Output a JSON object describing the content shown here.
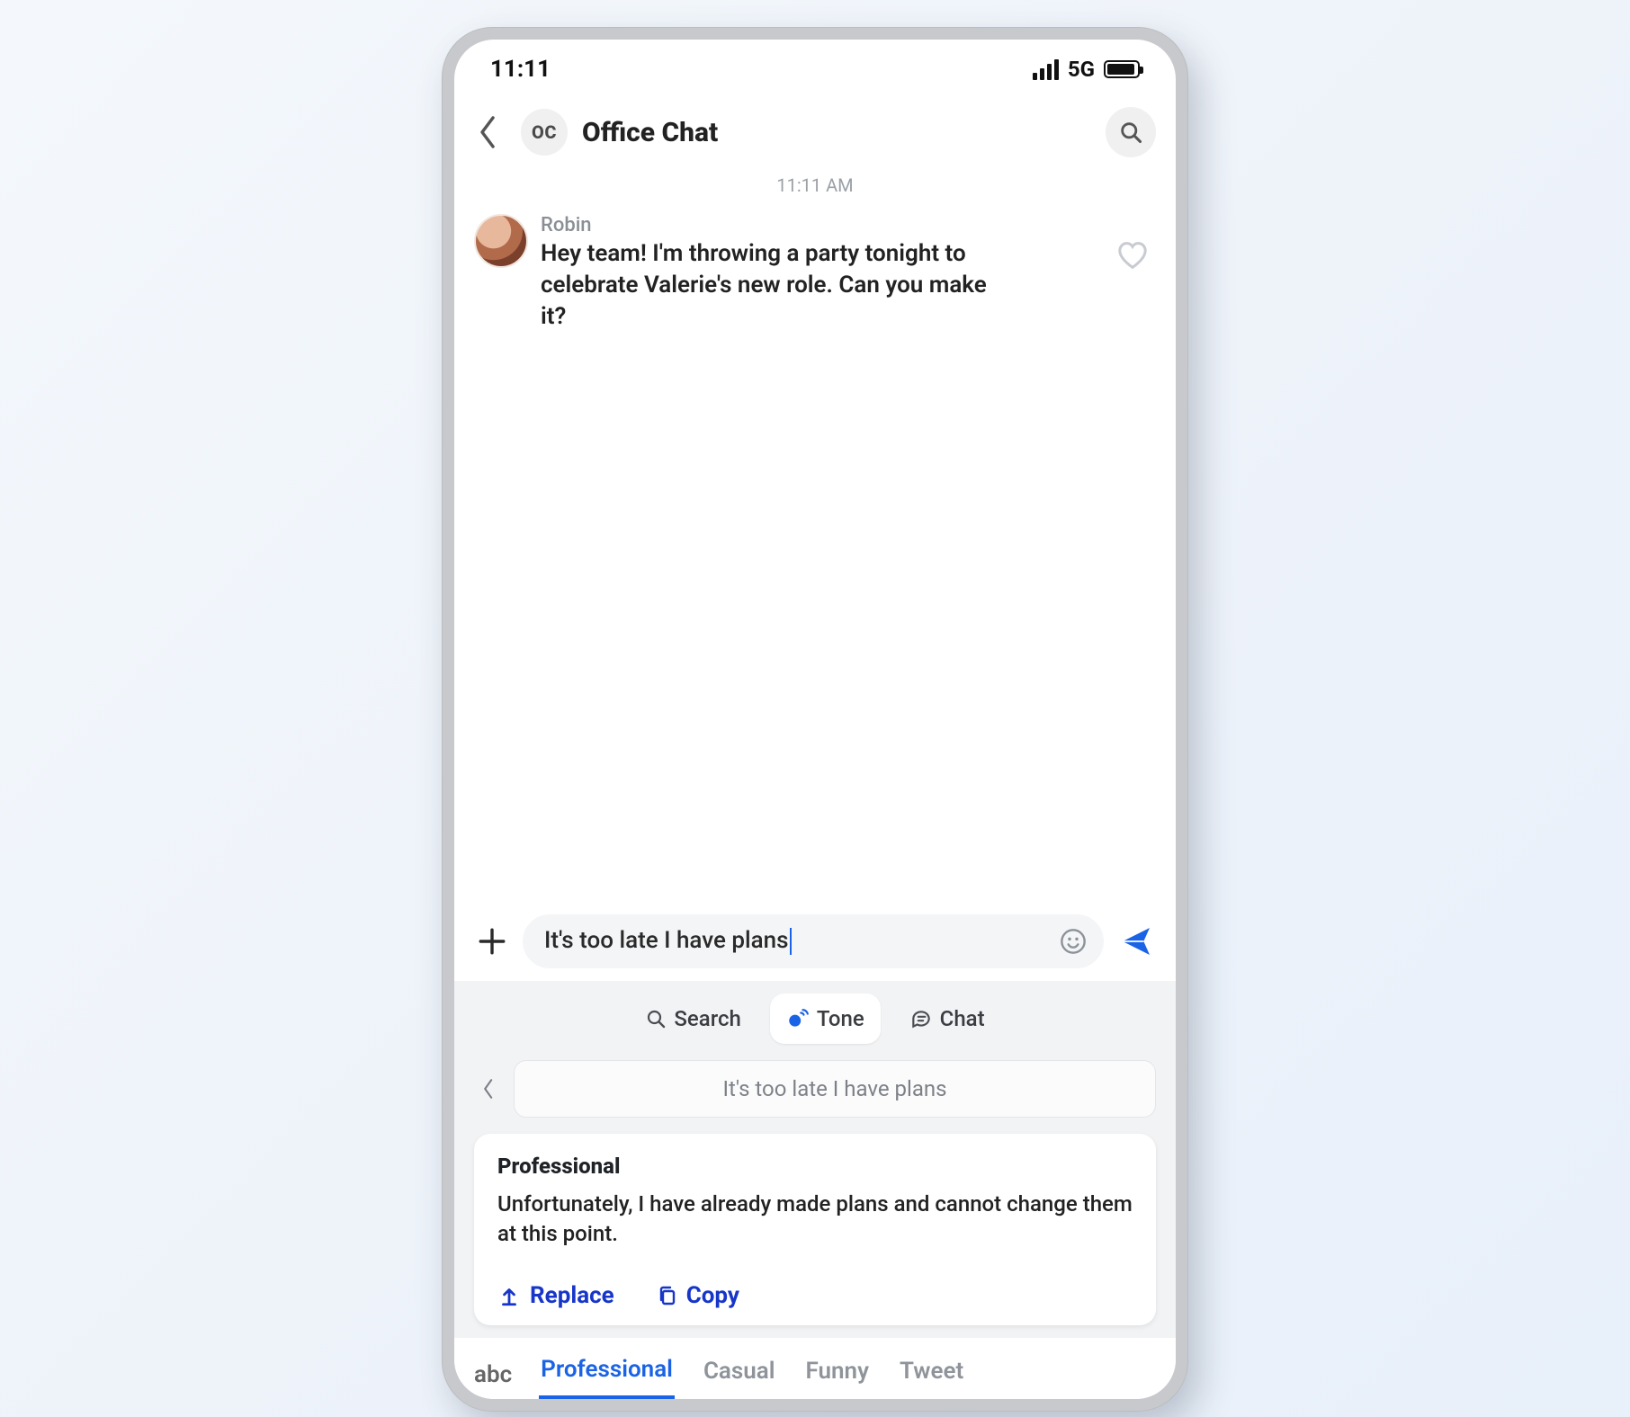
{
  "status": {
    "time": "11:11",
    "network": "5G"
  },
  "header": {
    "avatar_initials": "OC",
    "title": "Office Chat"
  },
  "thread": {
    "timestamp": "11:11 AM",
    "message": {
      "sender": "Robin",
      "text": "Hey team! I'm throwing a party tonight to celebrate Valerie's new role. Can you make it?"
    }
  },
  "compose": {
    "value": "It's too late I have plans"
  },
  "toolbar": {
    "search": "Search",
    "tone": "Tone",
    "chat": "Chat"
  },
  "echo": {
    "text": "It's too late I have plans"
  },
  "suggestion": {
    "title": "Professional",
    "body": "Unfortunately, I have already made plans and cannot change them at this point.",
    "replace": "Replace",
    "copy": "Copy"
  },
  "tone_tabs": {
    "keyboard": "abc",
    "items": [
      "Professional",
      "Casual",
      "Funny",
      "Tweet"
    ],
    "active": "Professional"
  }
}
